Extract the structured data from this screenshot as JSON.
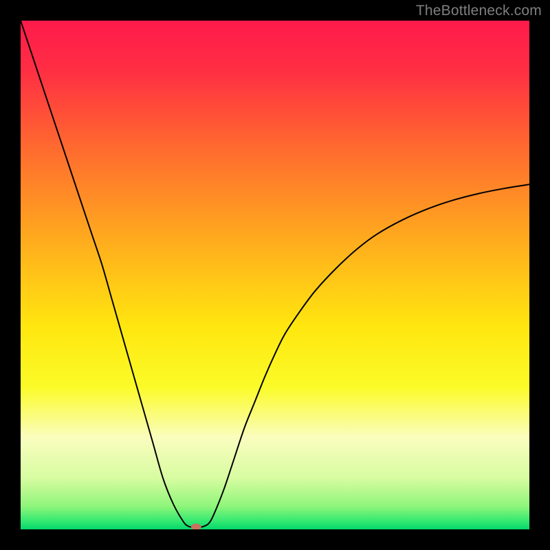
{
  "watermark": "TheBottleneck.com",
  "chart_data": {
    "type": "line",
    "title": "",
    "xlabel": "",
    "ylabel": "",
    "xlim": [
      0,
      100
    ],
    "ylim": [
      0,
      100
    ],
    "background_gradient": {
      "stops": [
        {
          "offset": 0.0,
          "color": "#ff1a4b"
        },
        {
          "offset": 0.1,
          "color": "#ff2f43"
        },
        {
          "offset": 0.25,
          "color": "#ff6a2f"
        },
        {
          "offset": 0.45,
          "color": "#ffb21c"
        },
        {
          "offset": 0.6,
          "color": "#ffe60f"
        },
        {
          "offset": 0.72,
          "color": "#fbfb28"
        },
        {
          "offset": 0.82,
          "color": "#fafdbf"
        },
        {
          "offset": 0.9,
          "color": "#d7fca0"
        },
        {
          "offset": 0.955,
          "color": "#8ef57a"
        },
        {
          "offset": 0.985,
          "color": "#2fe871"
        },
        {
          "offset": 1.0,
          "color": "#05d66a"
        }
      ]
    },
    "series": [
      {
        "name": "bottleneck-curve",
        "stroke": "#000000",
        "stroke_width": 2,
        "x": [
          0,
          2,
          4,
          6,
          8,
          10,
          12,
          14,
          16,
          18,
          20,
          22,
          24,
          26,
          28,
          30,
          32,
          33,
          34,
          35,
          36,
          37,
          38,
          40,
          42,
          44,
          46,
          48,
          50,
          52,
          55,
          58,
          62,
          66,
          70,
          75,
          80,
          85,
          90,
          95,
          100
        ],
        "y": [
          100,
          94,
          88,
          82,
          76,
          70,
          64,
          58,
          52,
          45,
          38,
          31,
          24,
          17,
          10,
          5,
          1.5,
          0.6,
          0.4,
          0.4,
          0.6,
          1.2,
          3,
          8,
          14,
          20,
          25,
          30,
          34.5,
          38.5,
          43,
          47,
          51.3,
          55,
          58,
          60.8,
          63,
          64.7,
          66,
          67,
          67.8
        ]
      }
    ],
    "marker": {
      "name": "optimal-point",
      "x": 34.5,
      "y": 0.5,
      "rx": 1.0,
      "ry": 0.65,
      "fill": "#c7725d"
    }
  }
}
